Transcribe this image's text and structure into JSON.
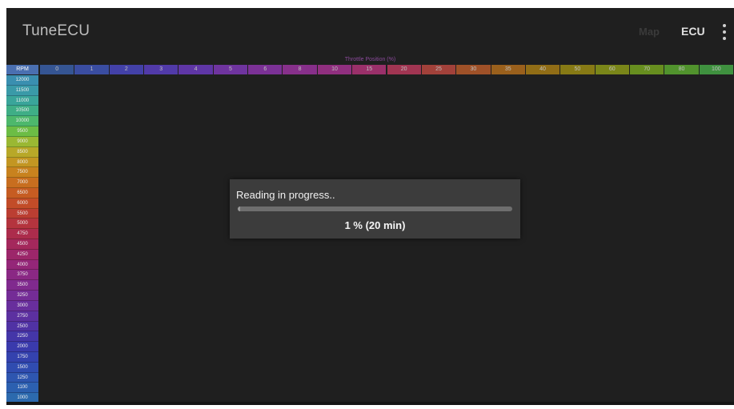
{
  "app": {
    "title": "TuneECU",
    "actions": {
      "map_label": "Map",
      "ecu_label": "ECU"
    }
  },
  "map_table": {
    "axis_title": "Throttle Position (%)",
    "rpm_header": "RPM",
    "throttle_columns": [
      "0",
      "1",
      "2",
      "3",
      "4",
      "5",
      "6",
      "8",
      "10",
      "15",
      "20",
      "25",
      "30",
      "35",
      "40",
      "50",
      "60",
      "70",
      "80",
      "100"
    ],
    "header_colors": [
      "#3a5fa8",
      "#3f56b8",
      "#4a48c0",
      "#5a3fc2",
      "#6b3bbe",
      "#7d38b6",
      "#8c35ab",
      "#9a339e",
      "#a43290",
      "#b03378",
      "#b83a5c",
      "#b9483f",
      "#b65a2a",
      "#b06c1c",
      "#a67b15",
      "#9a8a14",
      "#8a9818",
      "#74a220",
      "#5aa830",
      "#45a545"
    ],
    "rpm_rows": [
      "12000",
      "11500",
      "11000",
      "10500",
      "10000",
      "9500",
      "9000",
      "8500",
      "8000",
      "7500",
      "7000",
      "6500",
      "6000",
      "5500",
      "5000",
      "4750",
      "4500",
      "4250",
      "4000",
      "3750",
      "3500",
      "3250",
      "3000",
      "2750",
      "2500",
      "2250",
      "2000",
      "1750",
      "1500",
      "1250",
      "1100",
      "1000"
    ],
    "row_colors": [
      "#3a8fb0",
      "#3a9aa8",
      "#3aa59a",
      "#3fae86",
      "#4db86c",
      "#6cbd45",
      "#9ab833",
      "#b8a828",
      "#c39622",
      "#c8821e",
      "#c86e1f",
      "#c65c22",
      "#c24c28",
      "#bb3e32",
      "#b4343e",
      "#ac2c4c",
      "#a4285c",
      "#9c266a",
      "#942678",
      "#8a2884",
      "#802a8e",
      "#742c96",
      "#682e9c",
      "#5c30a0",
      "#5032a4",
      "#4436a8",
      "#3a3aac",
      "#3442ae",
      "#304cb0",
      "#2e56b0",
      "#2c60b0",
      "#2c6aae"
    ]
  },
  "dialog": {
    "message": "Reading in progress..",
    "progress_text": "1 %  (20 min)",
    "progress_fraction": 0.01
  }
}
